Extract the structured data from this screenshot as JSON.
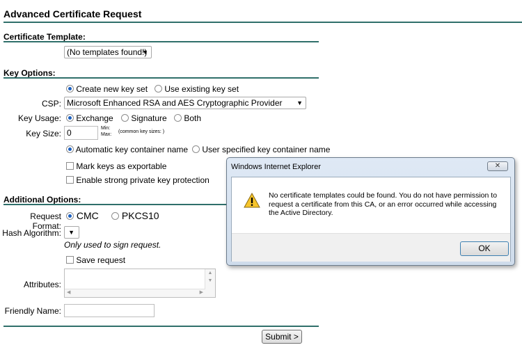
{
  "page": {
    "title": "Advanced Certificate Request"
  },
  "certificate_template": {
    "section_title": "Certificate Template:",
    "selected": "(No templates found!)"
  },
  "key_options": {
    "section_title": "Key Options:",
    "keyset_new": "Create new key set",
    "keyset_existing": "Use existing key set",
    "csp_label": "CSP:",
    "csp_value": "Microsoft Enhanced RSA and AES Cryptographic Provider",
    "key_usage_label": "Key Usage:",
    "usage_exchange": "Exchange",
    "usage_signature": "Signature",
    "usage_both": "Both",
    "key_size_label": "Key Size:",
    "key_size_value": "0",
    "min_label": "Min:",
    "max_label": "Max:",
    "common_sizes": "(common key sizes: )",
    "container_auto": "Automatic key container name",
    "container_user": "User specified key container name",
    "mark_exportable": "Mark keys as exportable",
    "strong_protection": "Enable strong private key protection"
  },
  "additional_options": {
    "section_title": "Additional Options:",
    "request_format_label": "Request Format:",
    "format_cmc": "CMC",
    "format_pkcs10": "PKCS10",
    "hash_label": "Hash Algorithm:",
    "hash_note": "Only used to sign request.",
    "save_request": "Save request",
    "attributes_label": "Attributes:",
    "friendly_name_label": "Friendly Name:"
  },
  "submit_label": "Submit >",
  "dialog": {
    "title": "Windows Internet Explorer",
    "close_glyph": "✕",
    "message": "No certificate templates could be found. You do not have permission to request a certificate from this CA, or an error occurred while accessing the Active Directory.",
    "ok_label": "OK"
  },
  "icons": {
    "dropdown": "chevron-down-icon",
    "warning": "warning-icon",
    "close": "close-icon"
  }
}
